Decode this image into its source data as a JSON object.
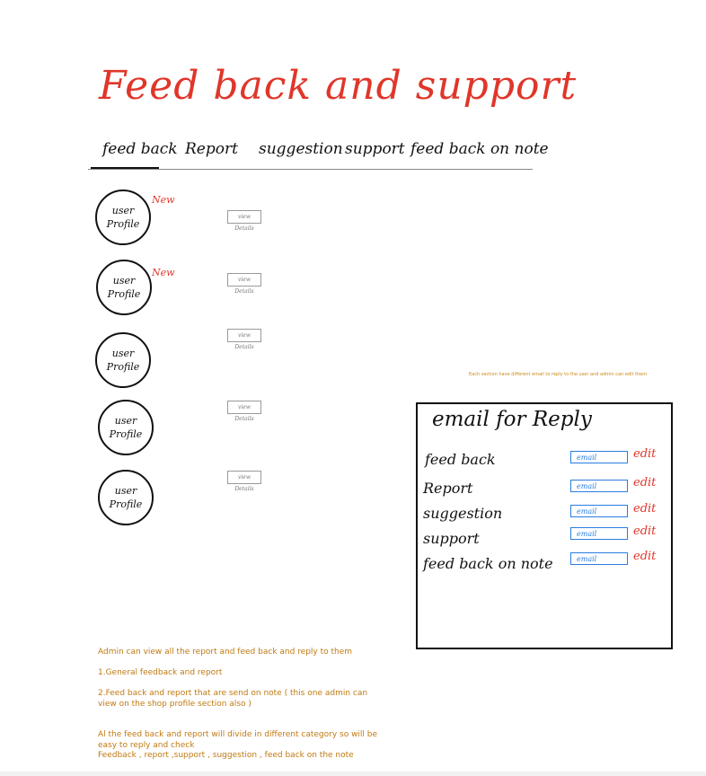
{
  "page": {
    "title": "Feed back and support"
  },
  "tabs": [
    {
      "label": "feed back",
      "active": true
    },
    {
      "label": "Report",
      "active": false
    },
    {
      "label": "suggestion",
      "active": false
    },
    {
      "label": "support",
      "active": false
    },
    {
      "label": "feed back on note",
      "active": false
    }
  ],
  "items": [
    {
      "avatar_line1": "user",
      "avatar_line2": "Profile",
      "badge": "New",
      "button": "view Details"
    },
    {
      "avatar_line1": "user",
      "avatar_line2": "Profile",
      "badge": "New",
      "button": "view Details"
    },
    {
      "avatar_line1": "user",
      "avatar_line2": "Profile",
      "badge": "",
      "button": "view Details"
    },
    {
      "avatar_line1": "user",
      "avatar_line2": "Profile",
      "badge": "",
      "button": "view Details"
    },
    {
      "avatar_line1": "user",
      "avatar_line2": "Profile",
      "badge": "",
      "button": "view Details"
    }
  ],
  "section_note": "Each section have different email to reply to the user and admin can edit them",
  "email_panel": {
    "title": "email for Reply",
    "rows": [
      {
        "label": "feed back",
        "value": "email",
        "edit": "edit"
      },
      {
        "label": "Report",
        "value": "email",
        "edit": "edit"
      },
      {
        "label": "suggestion",
        "value": "email",
        "edit": "edit"
      },
      {
        "label": "support",
        "value": "email",
        "edit": "edit"
      },
      {
        "label": "feed back on note",
        "value": "email",
        "edit": "edit"
      }
    ]
  },
  "notes": {
    "line1": "Admin can view all the report and feed back and reply to them",
    "line2": "1.General feedback and report",
    "line3a": "2.Feed back and report that are send on note ( this one admin can",
    "line3b": "view on the shop profile section also )",
    "line4a": "Al the feed back and report will divide in different category so will be",
    "line4b": "easy to reply and check",
    "line4c": "Feedback , report ,support , suggestion , feed back on the note"
  },
  "colors": {
    "accent_red": "#e0362a",
    "note_orange": "#c07a12",
    "input_blue": "#2a7de1"
  }
}
